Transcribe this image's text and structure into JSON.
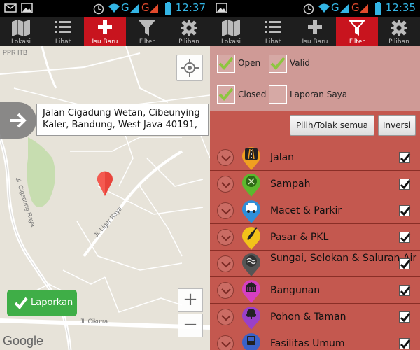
{
  "status_left": {
    "time": "12:37",
    "signal_g1": "G",
    "signal_g2": "G"
  },
  "status_right": {
    "time": "12:35",
    "signal_g1": "G",
    "signal_g2": "G"
  },
  "nav_tabs_left": [
    {
      "label": "Lokasi",
      "icon": "map-icon"
    },
    {
      "label": "Lihat",
      "icon": "list-icon"
    },
    {
      "label": "Isu Baru",
      "icon": "plus-icon",
      "active": true
    },
    {
      "label": "Filter",
      "icon": "funnel-icon"
    },
    {
      "label": "Pilihan",
      "icon": "gear-icon"
    }
  ],
  "nav_tabs_right": [
    {
      "label": "Lokasi",
      "icon": "map-icon"
    },
    {
      "label": "Lihat",
      "icon": "list-icon"
    },
    {
      "label": "Isu Baru",
      "icon": "plus-icon"
    },
    {
      "label": "Filter",
      "icon": "funnel-icon",
      "active": true
    },
    {
      "label": "Pilihan",
      "icon": "gear-icon"
    }
  ],
  "map": {
    "address": "Jalan Cigadung Wetan, Cibeunying Kaler, Bandung, West Java 40191,",
    "labels": {
      "ppr": "PPR ITB",
      "cigadung_raya": "Jl. Cigadung Raya",
      "ligar_raya": "Jl. Ligar Raya",
      "cikutra": "Jl. Cikutra"
    },
    "report_button": "Laporkan",
    "zoom_in": "+",
    "zoom_out": "−",
    "attribution": "Google"
  },
  "filter": {
    "status_options": [
      {
        "label": "Open",
        "checked": true
      },
      {
        "label": "Valid",
        "checked": true
      },
      {
        "label": "Closed",
        "checked": true
      },
      {
        "label": "Laporan Saya",
        "checked": false
      }
    ],
    "toggle_all_button": "Pilih/Tolak semua",
    "invert_button": "Inversi",
    "categories": [
      {
        "label": "Jalan",
        "icon": "road-icon",
        "color": "#f0a020",
        "checked": true
      },
      {
        "label": "Sampah",
        "icon": "trash-icon",
        "color": "#5cb82e",
        "checked": true
      },
      {
        "label": "Macet & Parkir",
        "icon": "car-icon",
        "color": "#2f8fd8",
        "checked": true
      },
      {
        "label": "Pasar & PKL",
        "icon": "chili-icon",
        "color": "#f2c21a",
        "checked": true
      },
      {
        "label": "Sungai, Selokan & Saluran Air",
        "icon": "river-icon",
        "color": "#555555",
        "checked": true
      },
      {
        "label": "Bangunan",
        "icon": "building-icon",
        "color": "#d63fc2",
        "checked": true
      },
      {
        "label": "Pohon & Taman",
        "icon": "tree-icon",
        "color": "#9a40c8",
        "checked": true
      },
      {
        "label": "Fasilitas Umum",
        "icon": "facility-icon",
        "color": "#3b62c8",
        "checked": true
      }
    ]
  },
  "colors": {
    "accent_red": "#c8141e",
    "filter_top_bg": "#cf9a96",
    "filter_list_bg": "#c4584f",
    "report_green": "#3fae47",
    "status_blue": "#33b5e5"
  }
}
